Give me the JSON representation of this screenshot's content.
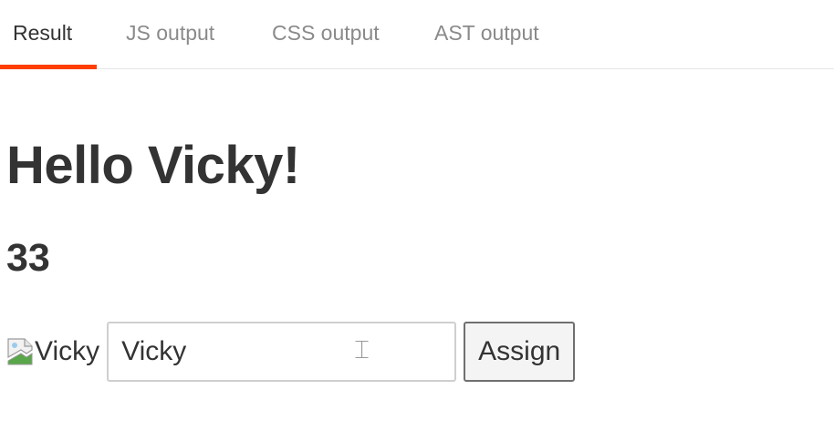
{
  "tabs": [
    {
      "label": "Result",
      "active": true
    },
    {
      "label": "JS output",
      "active": false
    },
    {
      "label": "CSS output",
      "active": false
    },
    {
      "label": "AST output",
      "active": false
    }
  ],
  "result": {
    "heading": "Hello Vicky!",
    "count": "33",
    "image_alt": "Vicky",
    "input_value": "Vicky",
    "button_label": "Assign"
  },
  "colors": {
    "accent": "#ff3e00",
    "text": "#333333",
    "muted_tab": "#8a8a8a"
  },
  "icons": {
    "broken_image": "broken-image-icon",
    "cursor": "text-cursor-icon"
  }
}
